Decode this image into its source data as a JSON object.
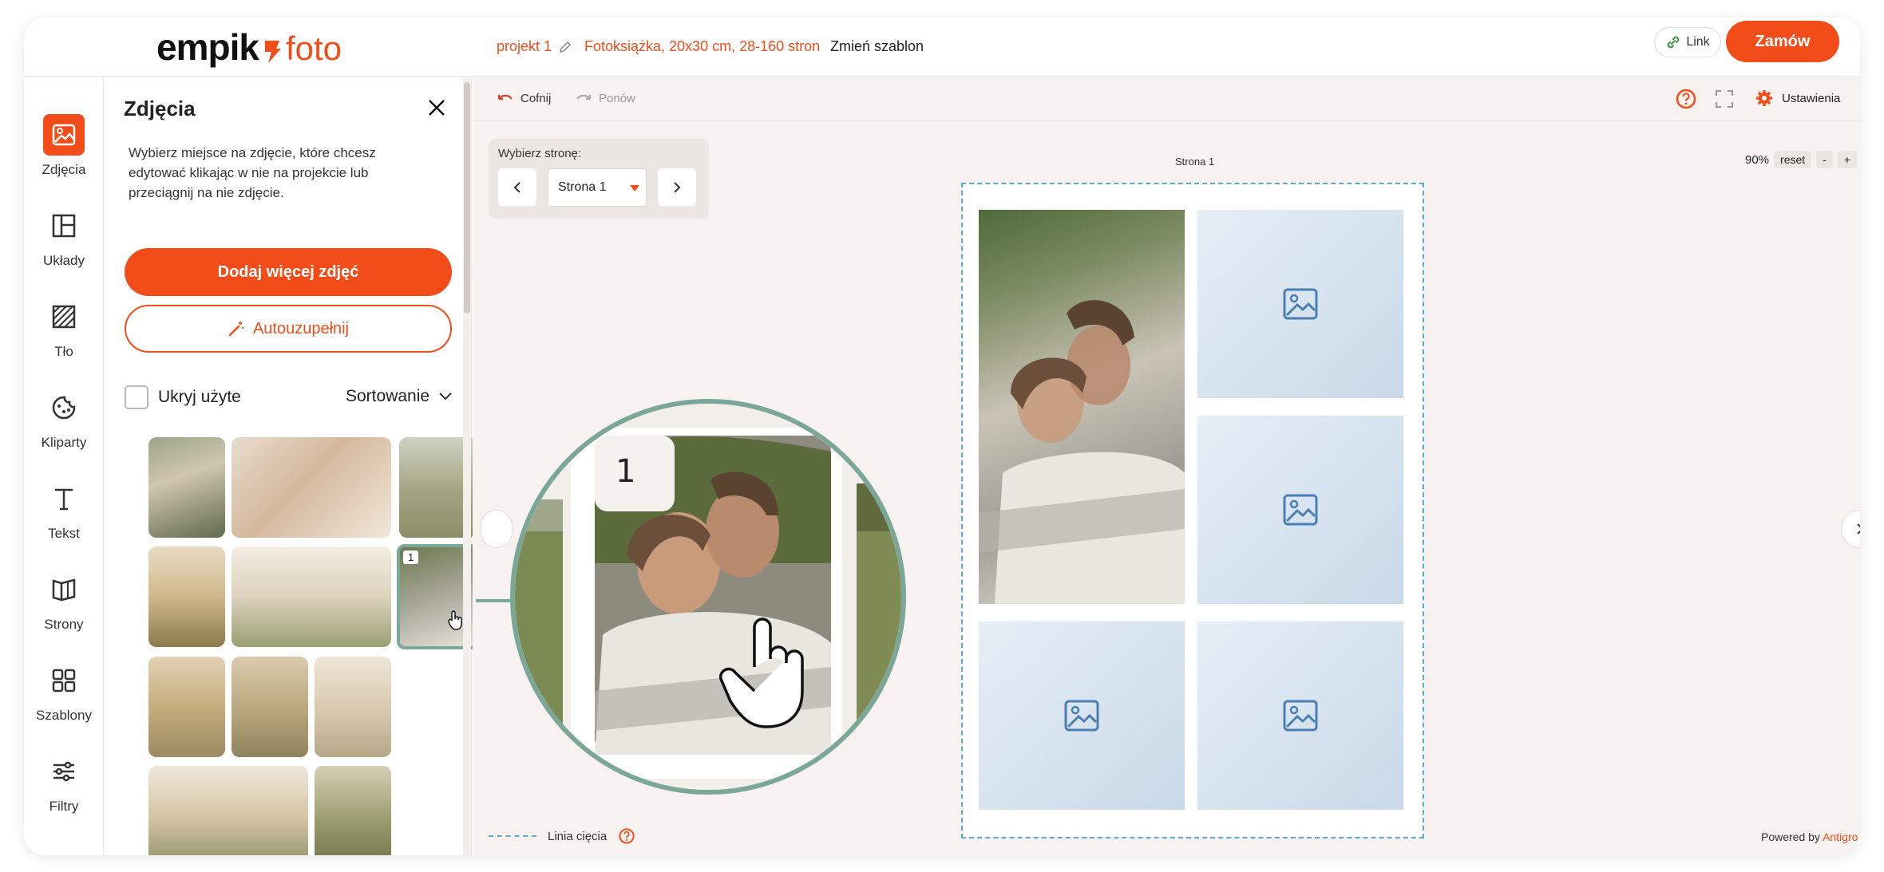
{
  "header": {
    "logo_text": "empik",
    "logo_foto": "foto",
    "project_name": "projekt 1",
    "product": "Fotoksiążka, 20x30 cm, 28-160 stron",
    "change_template": "Zmień szablon",
    "link_label": "Link",
    "order_label": "Zamów"
  },
  "rail": {
    "items": [
      {
        "label": "Zdjęcia",
        "icon": "image-icon",
        "active": true
      },
      {
        "label": "Układy",
        "icon": "layout-icon"
      },
      {
        "label": "Tło",
        "icon": "background-icon"
      },
      {
        "label": "Kliparty",
        "icon": "clipart-icon"
      },
      {
        "label": "Tekst",
        "icon": "text-icon"
      },
      {
        "label": "Strony",
        "icon": "pages-icon"
      },
      {
        "label": "Szablony",
        "icon": "templates-icon"
      },
      {
        "label": "Filtry",
        "icon": "filters-icon"
      }
    ]
  },
  "panel": {
    "title": "Zdjęcia",
    "description": "Wybierz miejsce na zdjęcie, które chcesz edytować klikając w nie na projekcie lub przeciągnij na nie zdjęcie.",
    "add_more": "Dodaj więcej zdjęć",
    "autofill": "Autouzupełnij",
    "hide_used": "Ukryj użyte",
    "sort": "Sortowanie",
    "selected_number": "1"
  },
  "toolbar": {
    "undo": "Cofnij",
    "redo": "Ponów",
    "settings": "Ustawienia"
  },
  "page_selector": {
    "label": "Wybierz stronę:",
    "value": "Strona 1"
  },
  "canvas": {
    "page_label": "Strona 1",
    "zoom": "90%",
    "reset": "reset",
    "zoom_out": "-",
    "zoom_in": "+",
    "cut_line": "Linia cięcia",
    "powered_by": "Powered by",
    "powered_brand": "Antigro"
  },
  "magnifier": {
    "number": "1"
  },
  "colors": {
    "accent": "#f24d19",
    "selection": "#7aa797",
    "cut_line": "#59a9d6"
  }
}
